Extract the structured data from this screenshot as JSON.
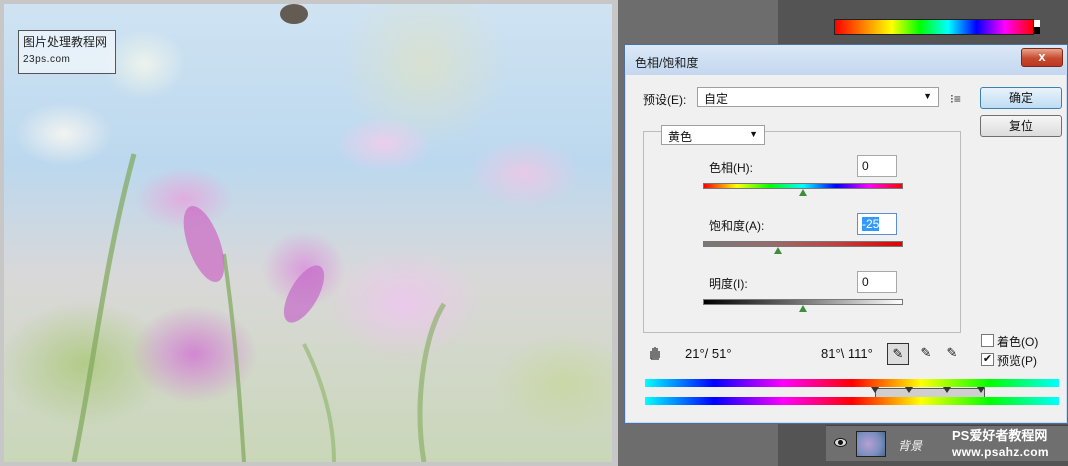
{
  "watermark": {
    "line1": "图片处理教程网",
    "line2": "23ps.com"
  },
  "dialog": {
    "title": "色相/饱和度",
    "close_label": "x",
    "preset_label": "预设(E):",
    "preset_value": "自定",
    "ok_label": "确定",
    "reset_label": "复位",
    "channel_value": "黄色",
    "hue": {
      "label": "色相(H):",
      "value": "0",
      "level": 0.5
    },
    "saturation": {
      "label": "饱和度(A):",
      "value": "-25",
      "level": 0.375
    },
    "lightness": {
      "label": "明度(I):",
      "value": "0",
      "level": 0.5
    },
    "range_left": "21°/ 51°",
    "range_right": "81°\\ 111°",
    "colorize_label": "着色(O)",
    "preview_label": "预览(P)",
    "preview_checked": true,
    "colorize_checked": false
  },
  "layers": {
    "layer_name": "背景"
  },
  "site": {
    "line1": "PS爱好者教程网",
    "line2": "www.psahz.com"
  },
  "icons": [
    "hand-icon",
    "eyedropper-icon",
    "eyedropper-plus-icon",
    "eyedropper-minus-icon",
    "eye-icon",
    "menu-icon",
    "chevron-down-icon"
  ]
}
